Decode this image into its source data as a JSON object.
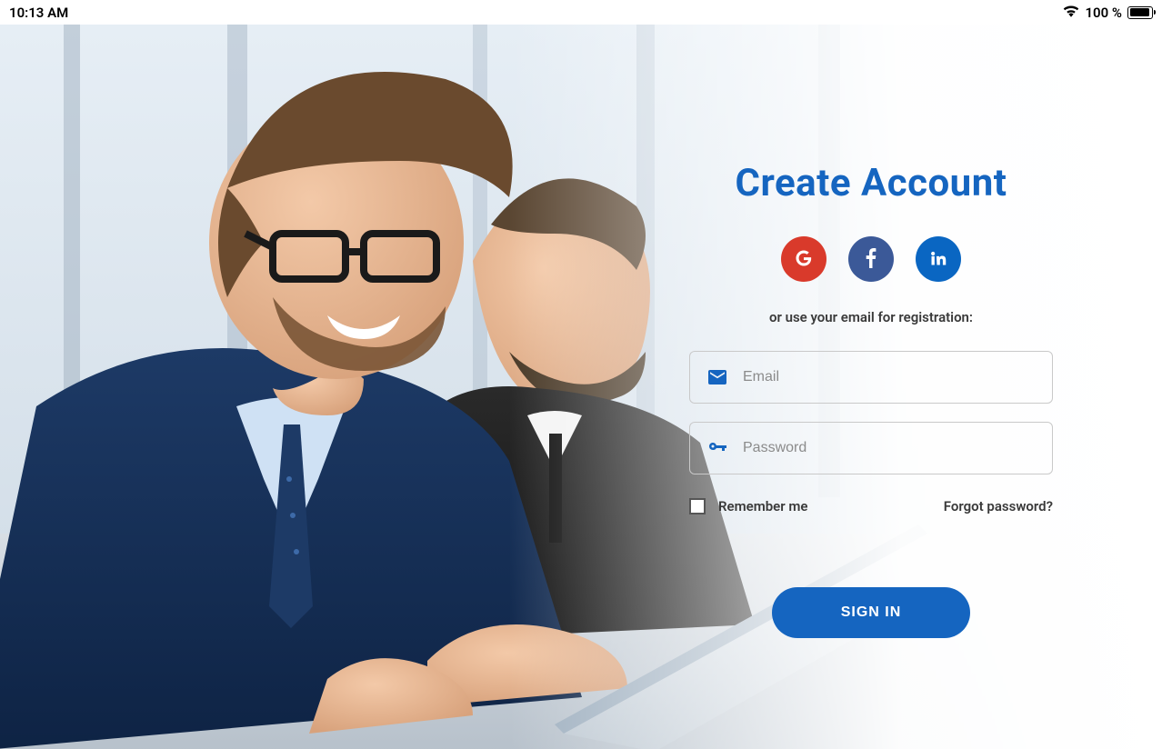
{
  "statusBar": {
    "time": "10:13 AM",
    "batteryText": "100 %"
  },
  "panel": {
    "title": "Create Account",
    "subtext": "or use your email for registration:",
    "emailPlaceholder": "Email",
    "passwordPlaceholder": "Password",
    "remember": "Remember me",
    "forgot": "Forgot password?",
    "signIn": "SIGN IN"
  },
  "social": {
    "google": "google",
    "facebook": "facebook",
    "linkedin": "linkedin"
  }
}
